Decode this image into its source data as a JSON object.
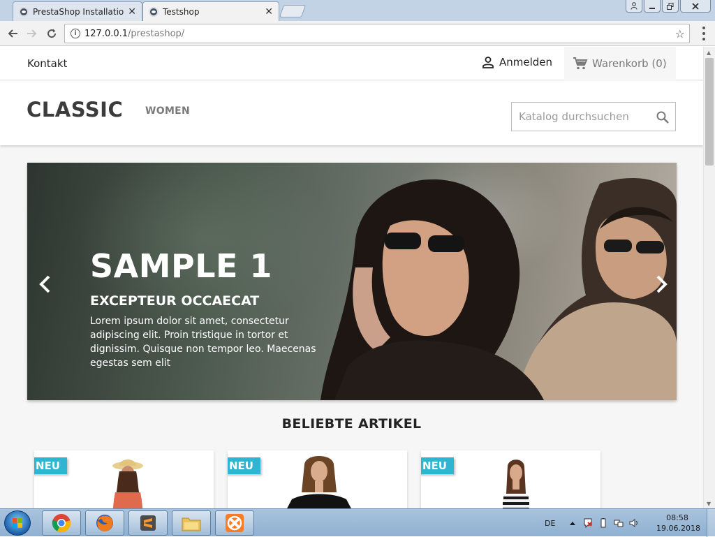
{
  "browser": {
    "tabs": [
      {
        "title": "PrestaShop Installation A",
        "close": "✕"
      },
      {
        "title": "Testshop",
        "close": "✕"
      }
    ],
    "url_host": "127.0.0.1",
    "url_path": "/prestashop/"
  },
  "shop": {
    "topbar": {
      "contact": "Kontakt",
      "signin": "Anmelden",
      "cart": "Warenkorb (0)"
    },
    "header": {
      "logo": "CLASSIC",
      "menu_women": "WOMEN",
      "search_placeholder": "Katalog durchsuchen"
    },
    "slider": {
      "title": "SAMPLE 1",
      "subtitle": "EXCEPTEUR OCCAECAT",
      "text": "Lorem ipsum dolor sit amet, consectetur adipiscing elit. Proin tristique in tortor et dignissim. Quisque non tempor leo. Maecenas egestas sem elit"
    },
    "section_title": "BELIEBTE ARTIKEL",
    "products": [
      {
        "badge": "NEU"
      },
      {
        "badge": "NEU"
      },
      {
        "badge": "NEU"
      }
    ]
  },
  "taskbar": {
    "language": "DE",
    "time": "08:58",
    "date": "19.06.2018"
  },
  "colors": {
    "accent": "#2fb5d2",
    "text_dark": "#232323",
    "muted": "#7a7a7a"
  }
}
